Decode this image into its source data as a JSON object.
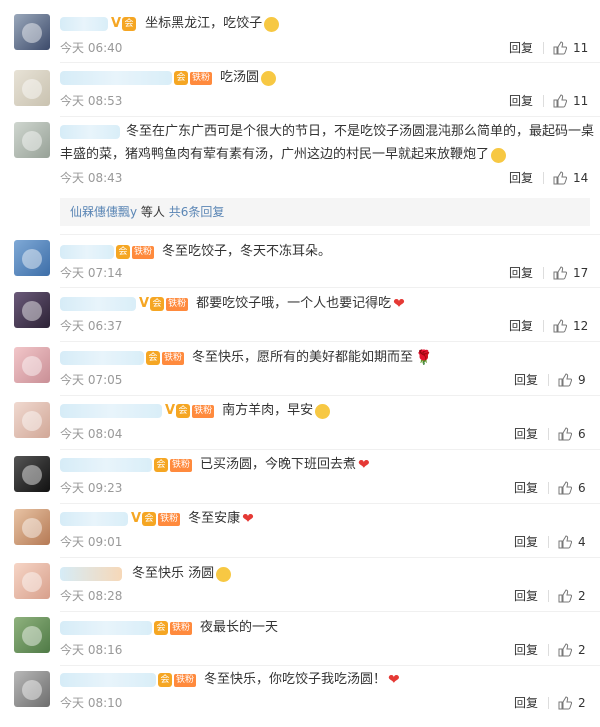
{
  "comments": [
    {
      "id": "c1",
      "badge": "V",
      "fan": "",
      "text": "坐标黑龙江，吃饺子",
      "emoji": "face",
      "time": "今天 06:40",
      "reply": "回复",
      "likes": "11"
    },
    {
      "id": "c2",
      "badge": "",
      "fan": "铁粉",
      "text": "吃汤圆",
      "emoji": "face",
      "time": "今天 08:53",
      "reply": "回复",
      "likes": "11"
    },
    {
      "id": "c3",
      "badge": "",
      "fan": "",
      "text_line1": "冬至在广东广西可是个很大的节日，不是吃饺子汤圆混沌那么简单的，最起码一桌",
      "text_line2": "丰盛的菜，猪鸡鸭鱼肉有荤有素有汤，广州这边的村民一早就起来放鞭炮了",
      "emoji": "face",
      "time": "今天 08:43",
      "reply": "回复",
      "likes": "14"
    },
    {
      "id": "c4",
      "badge": "",
      "fan": "铁粉",
      "text": "冬至吃饺子，冬天不冻耳朵。",
      "emoji": "",
      "time": "今天 07:14",
      "reply": "回复",
      "likes": "17"
    },
    {
      "id": "c5",
      "badge": "V",
      "fan": "铁粉",
      "text": "都要吃饺子哦，一个人也要记得吃",
      "emoji": "heart",
      "time": "今天 06:37",
      "reply": "回复",
      "likes": "12"
    },
    {
      "id": "c6",
      "badge": "",
      "fan": "铁粉",
      "text": "冬至快乐，愿所有的美好都能如期而至",
      "emoji": "rose",
      "time": "今天 07:05",
      "reply": "回复",
      "likes": "9"
    },
    {
      "id": "c7",
      "badge": "V",
      "fan": "铁粉",
      "text": "南方羊肉，早安",
      "emoji": "face",
      "time": "今天 08:04",
      "reply": "回复",
      "likes": "6"
    },
    {
      "id": "c8",
      "badge": "",
      "fan": "铁粉",
      "text": "已买汤圆，今晚下班回去煮",
      "emoji": "heart",
      "time": "今天 09:23",
      "reply": "回复",
      "likes": "6"
    },
    {
      "id": "c9",
      "badge": "V",
      "fan": "铁粉",
      "text": "冬至安康",
      "emoji": "heart",
      "time": "今天 09:01",
      "reply": "回复",
      "likes": "4"
    },
    {
      "id": "c10",
      "badge": "",
      "fan": "",
      "text": "冬至快乐 汤圆",
      "emoji": "face",
      "time": "今天 08:28",
      "reply": "回复",
      "likes": "2"
    },
    {
      "id": "c11",
      "badge": "",
      "fan": "铁粉",
      "text": "夜最长的一天",
      "emoji": "",
      "time": "今天 08:16",
      "reply": "回复",
      "likes": "2"
    },
    {
      "id": "c12",
      "badge": "",
      "fan": "铁粉",
      "text": "冬至快乐，你吃饺子我吃汤圆！",
      "emoji": "heart",
      "time": "今天 08:10",
      "reply": "回复",
      "likes": "2"
    }
  ],
  "subreply": {
    "user": "仙槑僡僡飄y",
    "mid": " 等人 ",
    "count_link": "共6条回复"
  },
  "colors": {
    "accent": "#5b86b5",
    "time": "#999999",
    "fan_badge": "#ff8a3d"
  }
}
